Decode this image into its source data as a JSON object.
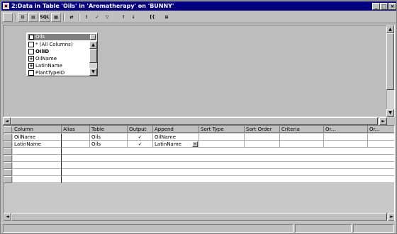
{
  "window": {
    "title": "2:Data in Table 'Oils' in 'Aromatherapy' on 'BUNNY'",
    "controls": {
      "minimize": "_",
      "maximize": "□",
      "close": "×"
    }
  },
  "toolbar": {
    "buttons": [
      {
        "name": "properties-icon",
        "label": ""
      },
      {
        "name": "show-diagram-pane",
        "label": "⊡"
      },
      {
        "name": "show-grid-pane",
        "label": "▤"
      },
      {
        "name": "show-sql-pane",
        "label": "SQL"
      },
      {
        "name": "show-results-pane",
        "label": "▦"
      },
      {
        "name": "change-query-type",
        "label": "⇄"
      },
      {
        "name": "run-icon",
        "label": "!"
      },
      {
        "name": "verify-sql",
        "label": "✓"
      },
      {
        "name": "remove-filter",
        "label": "▽"
      },
      {
        "name": "sort-ascending",
        "label": "↑"
      },
      {
        "name": "sort-descending",
        "label": "↓"
      },
      {
        "name": "use-group-by",
        "label": "[{"
      },
      {
        "name": "add-table",
        "label": "⊞"
      }
    ]
  },
  "diagram": {
    "table": {
      "name": "Oils",
      "fields": [
        {
          "label": "* (All Columns)",
          "checked": false,
          "key": false
        },
        {
          "label": "OilID",
          "checked": false,
          "key": true
        },
        {
          "label": "OilName",
          "checked": true,
          "key": false
        },
        {
          "label": "LatinName",
          "checked": true,
          "key": false
        },
        {
          "label": "PlantTypeID",
          "checked": false,
          "key": false
        }
      ]
    }
  },
  "grid": {
    "columns": [
      "Column",
      "Alias",
      "Table",
      "Output",
      "Append",
      "Sort Type",
      "Sort Order",
      "Criteria",
      "Or...",
      "Or...",
      "Or..."
    ],
    "rows": [
      {
        "column": "OilName",
        "alias": "",
        "table": "Oils",
        "output": "✓",
        "append": "OilName"
      },
      {
        "column": "LatinName",
        "alias": "",
        "table": "Oils",
        "output": "✓",
        "append": "LatinName"
      }
    ],
    "empty_rows": 6
  },
  "icons": {
    "check": "✓",
    "plus": "+",
    "arrow_up": "▲",
    "arrow_down": "▼",
    "arrow_left": "◄",
    "arrow_right": "►"
  }
}
